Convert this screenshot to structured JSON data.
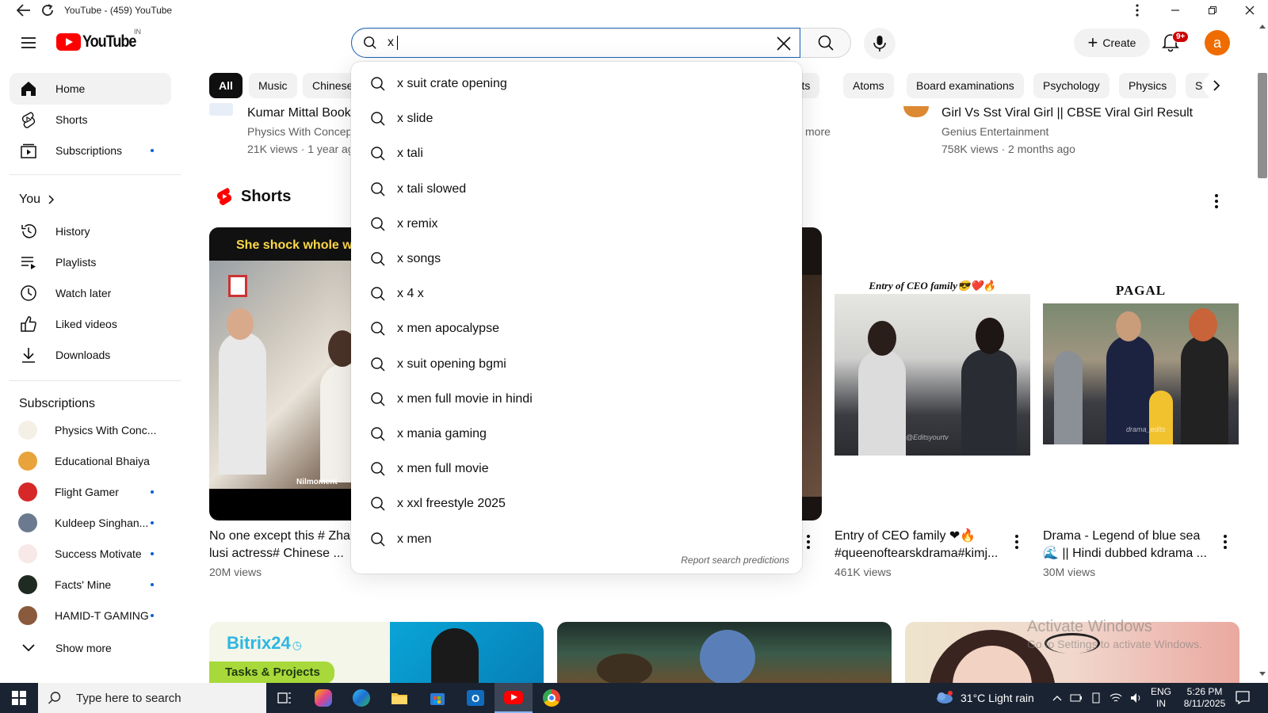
{
  "window": {
    "title": "YouTube - (459) YouTube"
  },
  "masthead": {
    "logo_text": "YouTube",
    "country_code": "IN",
    "search_value": "x",
    "create_label": "Create",
    "notif_badge": "9+",
    "avatar_letter": "a"
  },
  "sidebar": {
    "main": [
      {
        "label": "Home",
        "icon": "home-icon",
        "active": true
      },
      {
        "label": "Shorts",
        "icon": "shorts-icon"
      },
      {
        "label": "Subscriptions",
        "icon": "subscriptions-icon",
        "dot": true
      }
    ],
    "you_label": "You",
    "you_items": [
      {
        "label": "History",
        "icon": "history-icon"
      },
      {
        "label": "Playlists",
        "icon": "playlists-icon"
      },
      {
        "label": "Watch later",
        "icon": "clock-icon"
      },
      {
        "label": "Liked videos",
        "icon": "thumbs-up-icon"
      },
      {
        "label": "Downloads",
        "icon": "download-icon"
      }
    ],
    "subscriptions_label": "Subscriptions",
    "subscriptions": [
      {
        "label": "Physics With Conc...",
        "color": "#f5f0e6",
        "dot": false
      },
      {
        "label": "Educational Bhaiya",
        "color": "#e8a33a",
        "dot": false
      },
      {
        "label": "Flight Gamer",
        "color": "#d62828",
        "dot": true
      },
      {
        "label": "Kuldeep Singhan...",
        "color": "#6b7a8f",
        "dot": true
      },
      {
        "label": "Success Motivate",
        "color": "#f8e8e8",
        "dot": true
      },
      {
        "label": "Facts' Mine",
        "color": "#1f2a22",
        "dot": true
      },
      {
        "label": "HAMID-T GAMING",
        "color": "#8a5a3c",
        "dot": true
      }
    ],
    "show_more": "Show more"
  },
  "chips": [
    "All",
    "Music",
    "Chinese",
    "Thoughts",
    "Atoms",
    "Board examinations",
    "Psychology",
    "Physics",
    "S"
  ],
  "top_videos": {
    "left": {
      "title": "Kumar Mittal Book",
      "channel": "Physics With Concep",
      "meta": "21K views · 1 year ag"
    },
    "middle_more": "more",
    "right": {
      "title": "Girl Vs Sst Viral Girl || CBSE Viral Girl Result",
      "channel": "Genius Entertainment",
      "meta": "758K views · 2 months ago"
    }
  },
  "shorts": {
    "heading": "Shorts",
    "items": [
      {
        "overlay": "She shock whole w",
        "watermark": "Nilmoment",
        "title1": "No one except this # Zha",
        "title2": "lusi actress# Chinese ...",
        "views": "20M views"
      },
      {
        "title1": "",
        "title2": "",
        "views": ""
      },
      {
        "caption": "Entry of CEO family😎❤️🔥",
        "mark": "@Editsyourtv",
        "title1": "Entry of CEO family ❤🔥",
        "title2": "#queenoftearskdrama#kimj...",
        "views": "461K views"
      },
      {
        "caption": "PAGAL",
        "mark": "drama_edits",
        "title1": "Drama - Legend of blue sea",
        "title2": "🌊 || Hindi dubbed kdrama ...",
        "views": "30M views"
      }
    ]
  },
  "ads": {
    "bitrix_brand": "Bitrix24",
    "bitrix_tag": "Tasks & Projects"
  },
  "suggestions": [
    "x suit crate opening",
    "x slide",
    "x tali",
    "x tali slowed",
    "x remix",
    "x songs",
    "x 4 x",
    "x men apocalypse",
    "x suit opening bgmi",
    "x men full movie in hindi",
    "x mania gaming",
    "x men full movie",
    "x xxl freestyle 2025",
    "x men"
  ],
  "report_predictions": "Report search predictions",
  "watermark": {
    "line1": "Activate Windows",
    "line2": "Go to Settings to activate Windows."
  },
  "taskbar": {
    "search_placeholder": "Type here to search",
    "weather": "31°C  Light rain",
    "lang1": "ENG",
    "lang2": "IN",
    "time": "5:26 PM",
    "date": "8/11/2025"
  }
}
